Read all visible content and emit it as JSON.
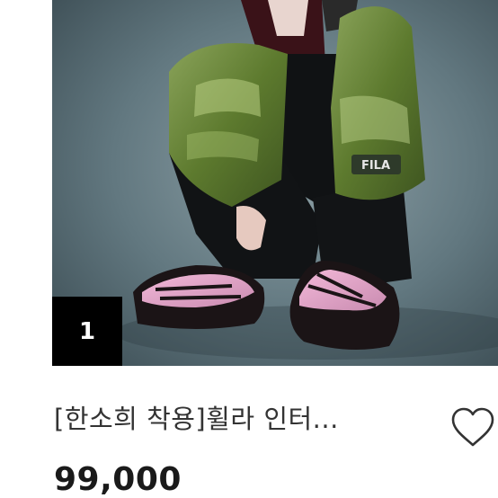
{
  "product": {
    "rank": "1",
    "title": "[한소희 착용]휠라 인터...",
    "price": "99,000",
    "image_logo_text": "FILA",
    "like_icon": "heart-outline-icon"
  }
}
